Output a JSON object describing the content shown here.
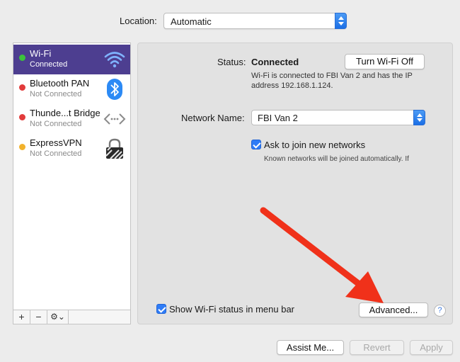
{
  "location": {
    "label": "Location:",
    "value": "Automatic"
  },
  "services": [
    {
      "name": "Wi-Fi",
      "status": "Connected",
      "dot_color": "#3cc33c",
      "icon": "wifi-icon"
    },
    {
      "name": "Bluetooth PAN",
      "status": "Not Connected",
      "dot_color": "#e23b3b",
      "icon": "bluetooth-icon"
    },
    {
      "name": "Thunde...t Bridge",
      "status": "Not Connected",
      "dot_color": "#e23b3b",
      "icon": "thunderbolt-bridge-icon"
    },
    {
      "name": "ExpressVPN",
      "status": "Not Connected",
      "dot_color": "#f2b22c",
      "icon": "vpn-lock-icon"
    }
  ],
  "toolbar": {
    "add": "+",
    "remove": "−",
    "actions": "⚙⌄"
  },
  "detail": {
    "status_label": "Status:",
    "status_value": "Connected",
    "turn_off_button": "Turn Wi-Fi Off",
    "status_desc_line1": "Wi-Fi is connected to FBI Van 2 and has the IP",
    "status_desc_line2": "address 192.168.1.124.",
    "network_name_label": "Network Name:",
    "network_name_value": "FBI Van 2",
    "ask_join_label": "Ask to join new networks",
    "ask_join_checked": true,
    "ask_join_desc": "Known networks will be joined automatically. If",
    "show_status_label": "Show Wi-Fi status in menu bar",
    "show_status_checked": true,
    "advanced_button": "Advanced...",
    "help": "?"
  },
  "footer": {
    "assist": "Assist Me...",
    "revert": "Revert",
    "apply": "Apply"
  },
  "colors": {
    "selection": "#4d3e90",
    "accent": "#2f7cf6",
    "arrow": "#f0311a"
  }
}
